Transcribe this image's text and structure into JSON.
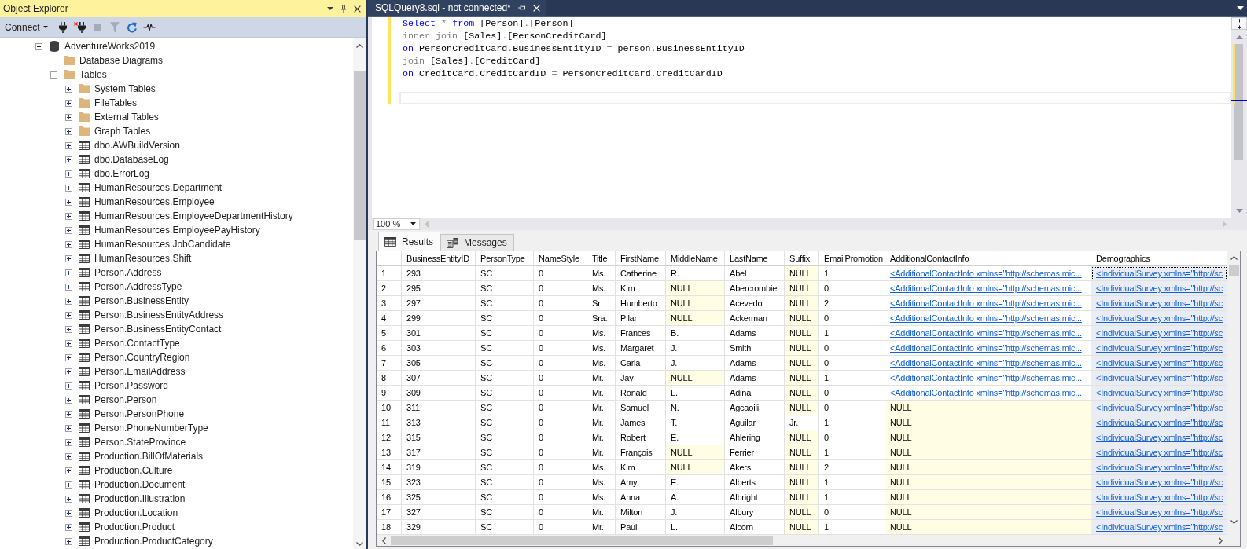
{
  "object_explorer": {
    "title": "Object Explorer",
    "connect_label": "Connect",
    "tools": [
      {
        "disabled": false
      },
      {
        "disabled": false
      },
      {
        "disabled": true
      },
      {
        "disabled": true
      },
      {
        "disabled": false
      },
      {
        "disabled": false
      }
    ],
    "tree": [
      {
        "label": "AdventureWorks2019",
        "kind": "database",
        "expanded": true,
        "children": [
          {
            "label": "Database Diagrams",
            "kind": "folder"
          },
          {
            "label": "Tables",
            "kind": "folder",
            "expanded": true,
            "children": [
              {
                "label": "System Tables",
                "kind": "folder",
                "expanded": false
              },
              {
                "label": "FileTables",
                "kind": "folder",
                "expanded": false
              },
              {
                "label": "External Tables",
                "kind": "folder",
                "expanded": false
              },
              {
                "label": "Graph Tables",
                "kind": "folder",
                "expanded": false
              },
              {
                "label": "dbo.AWBuildVersion",
                "kind": "table",
                "expanded": false
              },
              {
                "label": "dbo.DatabaseLog",
                "kind": "table",
                "expanded": false
              },
              {
                "label": "dbo.ErrorLog",
                "kind": "table",
                "expanded": false
              },
              {
                "label": "HumanResources.Department",
                "kind": "table",
                "expanded": false
              },
              {
                "label": "HumanResources.Employee",
                "kind": "table",
                "expanded": false
              },
              {
                "label": "HumanResources.EmployeeDepartmentHistory",
                "kind": "table",
                "expanded": false
              },
              {
                "label": "HumanResources.EmployeePayHistory",
                "kind": "table",
                "expanded": false
              },
              {
                "label": "HumanResources.JobCandidate",
                "kind": "table",
                "expanded": false
              },
              {
                "label": "HumanResources.Shift",
                "kind": "table",
                "expanded": false
              },
              {
                "label": "Person.Address",
                "kind": "table",
                "expanded": false
              },
              {
                "label": "Person.AddressType",
                "kind": "table",
                "expanded": false
              },
              {
                "label": "Person.BusinessEntity",
                "kind": "table",
                "expanded": false
              },
              {
                "label": "Person.BusinessEntityAddress",
                "kind": "table",
                "expanded": false
              },
              {
                "label": "Person.BusinessEntityContact",
                "kind": "table",
                "expanded": false
              },
              {
                "label": "Person.ContactType",
                "kind": "table",
                "expanded": false
              },
              {
                "label": "Person.CountryRegion",
                "kind": "table",
                "expanded": false
              },
              {
                "label": "Person.EmailAddress",
                "kind": "table",
                "expanded": false
              },
              {
                "label": "Person.Password",
                "kind": "table",
                "expanded": false
              },
              {
                "label": "Person.Person",
                "kind": "table",
                "expanded": false
              },
              {
                "label": "Person.PersonPhone",
                "kind": "table",
                "expanded": false
              },
              {
                "label": "Person.PhoneNumberType",
                "kind": "table",
                "expanded": false
              },
              {
                "label": "Person.StateProvince",
                "kind": "table",
                "expanded": false
              },
              {
                "label": "Production.BillOfMaterials",
                "kind": "table",
                "expanded": false
              },
              {
                "label": "Production.Culture",
                "kind": "table",
                "expanded": false
              },
              {
                "label": "Production.Document",
                "kind": "table",
                "expanded": false
              },
              {
                "label": "Production.Illustration",
                "kind": "table",
                "expanded": false
              },
              {
                "label": "Production.Location",
                "kind": "table",
                "expanded": false
              },
              {
                "label": "Production.Product",
                "kind": "table",
                "expanded": false
              },
              {
                "label": "Production.ProductCategory",
                "kind": "table",
                "expanded": false
              }
            ]
          }
        ]
      }
    ]
  },
  "editor": {
    "tabs": [
      {
        "label": "SQLQuery8.sql - not connected*",
        "selected": true
      }
    ],
    "unsaved": true,
    "lines": [
      {
        "tokens": [
          {
            "kind": "keyword",
            "text": "Select"
          },
          {
            "kind": "operator",
            "text": " * "
          },
          {
            "kind": "keyword",
            "text": "from"
          },
          {
            "kind": "identifier",
            "text": " [Person]"
          },
          {
            "kind": "operator",
            "text": "."
          },
          {
            "kind": "identifier",
            "text": "[Person]"
          }
        ]
      },
      {
        "tokens": [
          {
            "kind": "operator",
            "text": "inner join"
          },
          {
            "kind": "identifier",
            "text": " [Sales]"
          },
          {
            "kind": "operator",
            "text": "."
          },
          {
            "kind": "identifier",
            "text": "[PersonCreditCard]"
          }
        ]
      },
      {
        "tokens": [
          {
            "kind": "keyword",
            "text": "on"
          },
          {
            "kind": "identifier",
            "text": " PersonCreditCard"
          },
          {
            "kind": "operator",
            "text": "."
          },
          {
            "kind": "identifier",
            "text": "BusinessEntityID"
          },
          {
            "kind": "operator",
            "text": " = "
          },
          {
            "kind": "identifier",
            "text": "person"
          },
          {
            "kind": "operator",
            "text": "."
          },
          {
            "kind": "identifier",
            "text": "BusinessEntityID"
          }
        ]
      },
      {
        "tokens": [
          {
            "kind": "operator",
            "text": "join"
          },
          {
            "kind": "identifier",
            "text": " [Sales]"
          },
          {
            "kind": "operator",
            "text": "."
          },
          {
            "kind": "identifier",
            "text": "[CreditCard]"
          }
        ]
      },
      {
        "tokens": [
          {
            "kind": "keyword",
            "text": "on"
          },
          {
            "kind": "identifier",
            "text": " CreditCard"
          },
          {
            "kind": "operator",
            "text": "."
          },
          {
            "kind": "identifier",
            "text": "CreditCardID"
          },
          {
            "kind": "operator",
            "text": " = "
          },
          {
            "kind": "identifier",
            "text": "PersonCreditCard"
          },
          {
            "kind": "operator",
            "text": "."
          },
          {
            "kind": "identifier",
            "text": "CreditCardID"
          }
        ]
      }
    ],
    "zoom": "100 %"
  },
  "results": {
    "tabs": [
      {
        "label": "Results",
        "selected": true
      },
      {
        "label": "Messages",
        "selected": false
      }
    ],
    "columns": [
      {
        "label": "BusinessEntityID",
        "kind": "text",
        "selected": false
      },
      {
        "label": "PersonType",
        "kind": "text",
        "selected": false
      },
      {
        "label": "NameStyle",
        "kind": "text",
        "selected": false
      },
      {
        "label": "Title",
        "kind": "text",
        "selected": false
      },
      {
        "label": "FirstName",
        "kind": "text",
        "selected": false
      },
      {
        "label": "MiddleName",
        "kind": "text",
        "selected": false
      },
      {
        "label": "LastName",
        "kind": "text",
        "selected": false
      },
      {
        "label": "Suffix",
        "kind": "text",
        "selected": false
      },
      {
        "label": "EmailPromotion",
        "kind": "text",
        "selected": false
      },
      {
        "label": "AdditionalContactInfo",
        "kind": "xml",
        "selected": false
      },
      {
        "label": "Demographics",
        "kind": "xml",
        "selected": true
      }
    ],
    "rows": [
      {
        "number": "1",
        "current": true,
        "cells": [
          {
            "text": "293",
            "null": false
          },
          {
            "text": "SC",
            "null": false
          },
          {
            "text": "0",
            "null": false
          },
          {
            "text": "Ms.",
            "null": false
          },
          {
            "text": "Catherine",
            "null": false
          },
          {
            "text": "R.",
            "null": false
          },
          {
            "text": "Abel",
            "null": false
          },
          {
            "text": "NULL",
            "null": true
          },
          {
            "text": "1",
            "null": false
          },
          {
            "text": "<AdditionalContactInfo xmlns=\"http://schemas.mic...",
            "null": false
          },
          {
            "text": "<IndividualSurvey xmlns=\"http://sc",
            "null": false
          }
        ]
      },
      {
        "number": "2",
        "current": false,
        "cells": [
          {
            "text": "295",
            "null": false
          },
          {
            "text": "SC",
            "null": false
          },
          {
            "text": "0",
            "null": false
          },
          {
            "text": "Ms.",
            "null": false
          },
          {
            "text": "Kim",
            "null": false
          },
          {
            "text": "NULL",
            "null": true
          },
          {
            "text": "Abercrombie",
            "null": false
          },
          {
            "text": "NULL",
            "null": true
          },
          {
            "text": "0",
            "null": false
          },
          {
            "text": "<AdditionalContactInfo xmlns=\"http://schemas.mic...",
            "null": false
          },
          {
            "text": "<IndividualSurvey xmlns=\"http://sc",
            "null": false
          }
        ]
      },
      {
        "number": "3",
        "current": false,
        "cells": [
          {
            "text": "297",
            "null": false
          },
          {
            "text": "SC",
            "null": false
          },
          {
            "text": "0",
            "null": false
          },
          {
            "text": "Sr.",
            "null": false
          },
          {
            "text": "Humberto",
            "null": false
          },
          {
            "text": "NULL",
            "null": true
          },
          {
            "text": "Acevedo",
            "null": false
          },
          {
            "text": "NULL",
            "null": true
          },
          {
            "text": "2",
            "null": false
          },
          {
            "text": "<AdditionalContactInfo xmlns=\"http://schemas.mic...",
            "null": false
          },
          {
            "text": "<IndividualSurvey xmlns=\"http://sc",
            "null": false
          }
        ]
      },
      {
        "number": "4",
        "current": false,
        "cells": [
          {
            "text": "299",
            "null": false
          },
          {
            "text": "SC",
            "null": false
          },
          {
            "text": "0",
            "null": false
          },
          {
            "text": "Sra.",
            "null": false
          },
          {
            "text": "Pilar",
            "null": false
          },
          {
            "text": "NULL",
            "null": true
          },
          {
            "text": "Ackerman",
            "null": false
          },
          {
            "text": "NULL",
            "null": true
          },
          {
            "text": "0",
            "null": false
          },
          {
            "text": "<AdditionalContactInfo xmlns=\"http://schemas.mic...",
            "null": false
          },
          {
            "text": "<IndividualSurvey xmlns=\"http://sc",
            "null": false
          }
        ]
      },
      {
        "number": "5",
        "current": false,
        "cells": [
          {
            "text": "301",
            "null": false
          },
          {
            "text": "SC",
            "null": false
          },
          {
            "text": "0",
            "null": false
          },
          {
            "text": "Ms.",
            "null": false
          },
          {
            "text": "Frances",
            "null": false
          },
          {
            "text": "B.",
            "null": false
          },
          {
            "text": "Adams",
            "null": false
          },
          {
            "text": "NULL",
            "null": true
          },
          {
            "text": "1",
            "null": false
          },
          {
            "text": "<AdditionalContactInfo xmlns=\"http://schemas.mic...",
            "null": false
          },
          {
            "text": "<IndividualSurvey xmlns=\"http://sc",
            "null": false
          }
        ]
      },
      {
        "number": "6",
        "current": false,
        "cells": [
          {
            "text": "303",
            "null": false
          },
          {
            "text": "SC",
            "null": false
          },
          {
            "text": "0",
            "null": false
          },
          {
            "text": "Ms.",
            "null": false
          },
          {
            "text": "Margaret",
            "null": false
          },
          {
            "text": "J.",
            "null": false
          },
          {
            "text": "Smith",
            "null": false
          },
          {
            "text": "NULL",
            "null": true
          },
          {
            "text": "0",
            "null": false
          },
          {
            "text": "<AdditionalContactInfo xmlns=\"http://schemas.mic...",
            "null": false
          },
          {
            "text": "<IndividualSurvey xmlns=\"http://sc",
            "null": false
          }
        ]
      },
      {
        "number": "7",
        "current": false,
        "cells": [
          {
            "text": "305",
            "null": false
          },
          {
            "text": "SC",
            "null": false
          },
          {
            "text": "0",
            "null": false
          },
          {
            "text": "Ms.",
            "null": false
          },
          {
            "text": "Carla",
            "null": false
          },
          {
            "text": "J.",
            "null": false
          },
          {
            "text": "Adams",
            "null": false
          },
          {
            "text": "NULL",
            "null": true
          },
          {
            "text": "0",
            "null": false
          },
          {
            "text": "<AdditionalContactInfo xmlns=\"http://schemas.mic...",
            "null": false
          },
          {
            "text": "<IndividualSurvey xmlns=\"http://sc",
            "null": false
          }
        ]
      },
      {
        "number": "8",
        "current": false,
        "cells": [
          {
            "text": "307",
            "null": false
          },
          {
            "text": "SC",
            "null": false
          },
          {
            "text": "0",
            "null": false
          },
          {
            "text": "Mr.",
            "null": false
          },
          {
            "text": "Jay",
            "null": false
          },
          {
            "text": "NULL",
            "null": true
          },
          {
            "text": "Adams",
            "null": false
          },
          {
            "text": "NULL",
            "null": true
          },
          {
            "text": "1",
            "null": false
          },
          {
            "text": "<AdditionalContactInfo xmlns=\"http://schemas.mic...",
            "null": false
          },
          {
            "text": "<IndividualSurvey xmlns=\"http://sc",
            "null": false
          }
        ]
      },
      {
        "number": "9",
        "current": false,
        "cells": [
          {
            "text": "309",
            "null": false
          },
          {
            "text": "SC",
            "null": false
          },
          {
            "text": "0",
            "null": false
          },
          {
            "text": "Mr.",
            "null": false
          },
          {
            "text": "Ronald",
            "null": false
          },
          {
            "text": "L.",
            "null": false
          },
          {
            "text": "Adina",
            "null": false
          },
          {
            "text": "NULL",
            "null": true
          },
          {
            "text": "0",
            "null": false
          },
          {
            "text": "<AdditionalContactInfo xmlns=\"http://schemas.mic...",
            "null": false
          },
          {
            "text": "<IndividualSurvey xmlns=\"http://sc",
            "null": false
          }
        ]
      },
      {
        "number": "10",
        "current": false,
        "cells": [
          {
            "text": "311",
            "null": false
          },
          {
            "text": "SC",
            "null": false
          },
          {
            "text": "0",
            "null": false
          },
          {
            "text": "Mr.",
            "null": false
          },
          {
            "text": "Samuel",
            "null": false
          },
          {
            "text": "N.",
            "null": false
          },
          {
            "text": "Agcaoili",
            "null": false
          },
          {
            "text": "NULL",
            "null": true
          },
          {
            "text": "0",
            "null": false
          },
          {
            "text": "NULL",
            "null": true
          },
          {
            "text": "<IndividualSurvey xmlns=\"http://sc",
            "null": false
          }
        ]
      },
      {
        "number": "11",
        "current": false,
        "cells": [
          {
            "text": "313",
            "null": false
          },
          {
            "text": "SC",
            "null": false
          },
          {
            "text": "0",
            "null": false
          },
          {
            "text": "Mr.",
            "null": false
          },
          {
            "text": "James",
            "null": false
          },
          {
            "text": "T.",
            "null": false
          },
          {
            "text": "Aguilar",
            "null": false
          },
          {
            "text": "Jr.",
            "null": false
          },
          {
            "text": "1",
            "null": false
          },
          {
            "text": "NULL",
            "null": true
          },
          {
            "text": "<IndividualSurvey xmlns=\"http://sc",
            "null": false
          }
        ]
      },
      {
        "number": "12",
        "current": false,
        "cells": [
          {
            "text": "315",
            "null": false
          },
          {
            "text": "SC",
            "null": false
          },
          {
            "text": "0",
            "null": false
          },
          {
            "text": "Mr.",
            "null": false
          },
          {
            "text": "Robert",
            "null": false
          },
          {
            "text": "E.",
            "null": false
          },
          {
            "text": "Ahlering",
            "null": false
          },
          {
            "text": "NULL",
            "null": true
          },
          {
            "text": "0",
            "null": false
          },
          {
            "text": "NULL",
            "null": true
          },
          {
            "text": "<IndividualSurvey xmlns=\"http://sc",
            "null": false
          }
        ]
      },
      {
        "number": "13",
        "current": false,
        "cells": [
          {
            "text": "317",
            "null": false
          },
          {
            "text": "SC",
            "null": false
          },
          {
            "text": "0",
            "null": false
          },
          {
            "text": "Mr.",
            "null": false
          },
          {
            "text": "François",
            "null": false
          },
          {
            "text": "NULL",
            "null": true
          },
          {
            "text": "Ferrier",
            "null": false
          },
          {
            "text": "NULL",
            "null": true
          },
          {
            "text": "1",
            "null": false
          },
          {
            "text": "NULL",
            "null": true
          },
          {
            "text": "<IndividualSurvey xmlns=\"http://sc",
            "null": false
          }
        ]
      },
      {
        "number": "14",
        "current": false,
        "cells": [
          {
            "text": "319",
            "null": false
          },
          {
            "text": "SC",
            "null": false
          },
          {
            "text": "0",
            "null": false
          },
          {
            "text": "Ms.",
            "null": false
          },
          {
            "text": "Kim",
            "null": false
          },
          {
            "text": "NULL",
            "null": true
          },
          {
            "text": "Akers",
            "null": false
          },
          {
            "text": "NULL",
            "null": true
          },
          {
            "text": "2",
            "null": false
          },
          {
            "text": "NULL",
            "null": true
          },
          {
            "text": "<IndividualSurvey xmlns=\"http://sc",
            "null": false
          }
        ]
      },
      {
        "number": "15",
        "current": false,
        "cells": [
          {
            "text": "323",
            "null": false
          },
          {
            "text": "SC",
            "null": false
          },
          {
            "text": "0",
            "null": false
          },
          {
            "text": "Ms.",
            "null": false
          },
          {
            "text": "Amy",
            "null": false
          },
          {
            "text": "E.",
            "null": false
          },
          {
            "text": "Alberts",
            "null": false
          },
          {
            "text": "NULL",
            "null": true
          },
          {
            "text": "1",
            "null": false
          },
          {
            "text": "NULL",
            "null": true
          },
          {
            "text": "<IndividualSurvey xmlns=\"http://sc",
            "null": false
          }
        ]
      },
      {
        "number": "16",
        "current": false,
        "cells": [
          {
            "text": "325",
            "null": false
          },
          {
            "text": "SC",
            "null": false
          },
          {
            "text": "0",
            "null": false
          },
          {
            "text": "Ms.",
            "null": false
          },
          {
            "text": "Anna",
            "null": false
          },
          {
            "text": "A.",
            "null": false
          },
          {
            "text": "Albright",
            "null": false
          },
          {
            "text": "NULL",
            "null": true
          },
          {
            "text": "1",
            "null": false
          },
          {
            "text": "NULL",
            "null": true
          },
          {
            "text": "<IndividualSurvey xmlns=\"http://sc",
            "null": false
          }
        ]
      },
      {
        "number": "17",
        "current": false,
        "cells": [
          {
            "text": "327",
            "null": false
          },
          {
            "text": "SC",
            "null": false
          },
          {
            "text": "0",
            "null": false
          },
          {
            "text": "Mr.",
            "null": false
          },
          {
            "text": "Milton",
            "null": false
          },
          {
            "text": "J.",
            "null": false
          },
          {
            "text": "Albury",
            "null": false
          },
          {
            "text": "NULL",
            "null": true
          },
          {
            "text": "0",
            "null": false
          },
          {
            "text": "NULL",
            "null": true
          },
          {
            "text": "<IndividualSurvey xmlns=\"http://sc",
            "null": false
          }
        ]
      },
      {
        "number": "18",
        "current": false,
        "cells": [
          {
            "text": "329",
            "null": false
          },
          {
            "text": "SC",
            "null": false
          },
          {
            "text": "0",
            "null": false
          },
          {
            "text": "Mr.",
            "null": false
          },
          {
            "text": "Paul",
            "null": false
          },
          {
            "text": "L.",
            "null": false
          },
          {
            "text": "Alcorn",
            "null": false
          },
          {
            "text": "NULL",
            "null": true
          },
          {
            "text": "1",
            "null": false
          },
          {
            "text": "NULL",
            "null": true
          },
          {
            "text": "<IndividualSurvey xmlns=\"http://sc",
            "null": false
          }
        ]
      }
    ]
  }
}
